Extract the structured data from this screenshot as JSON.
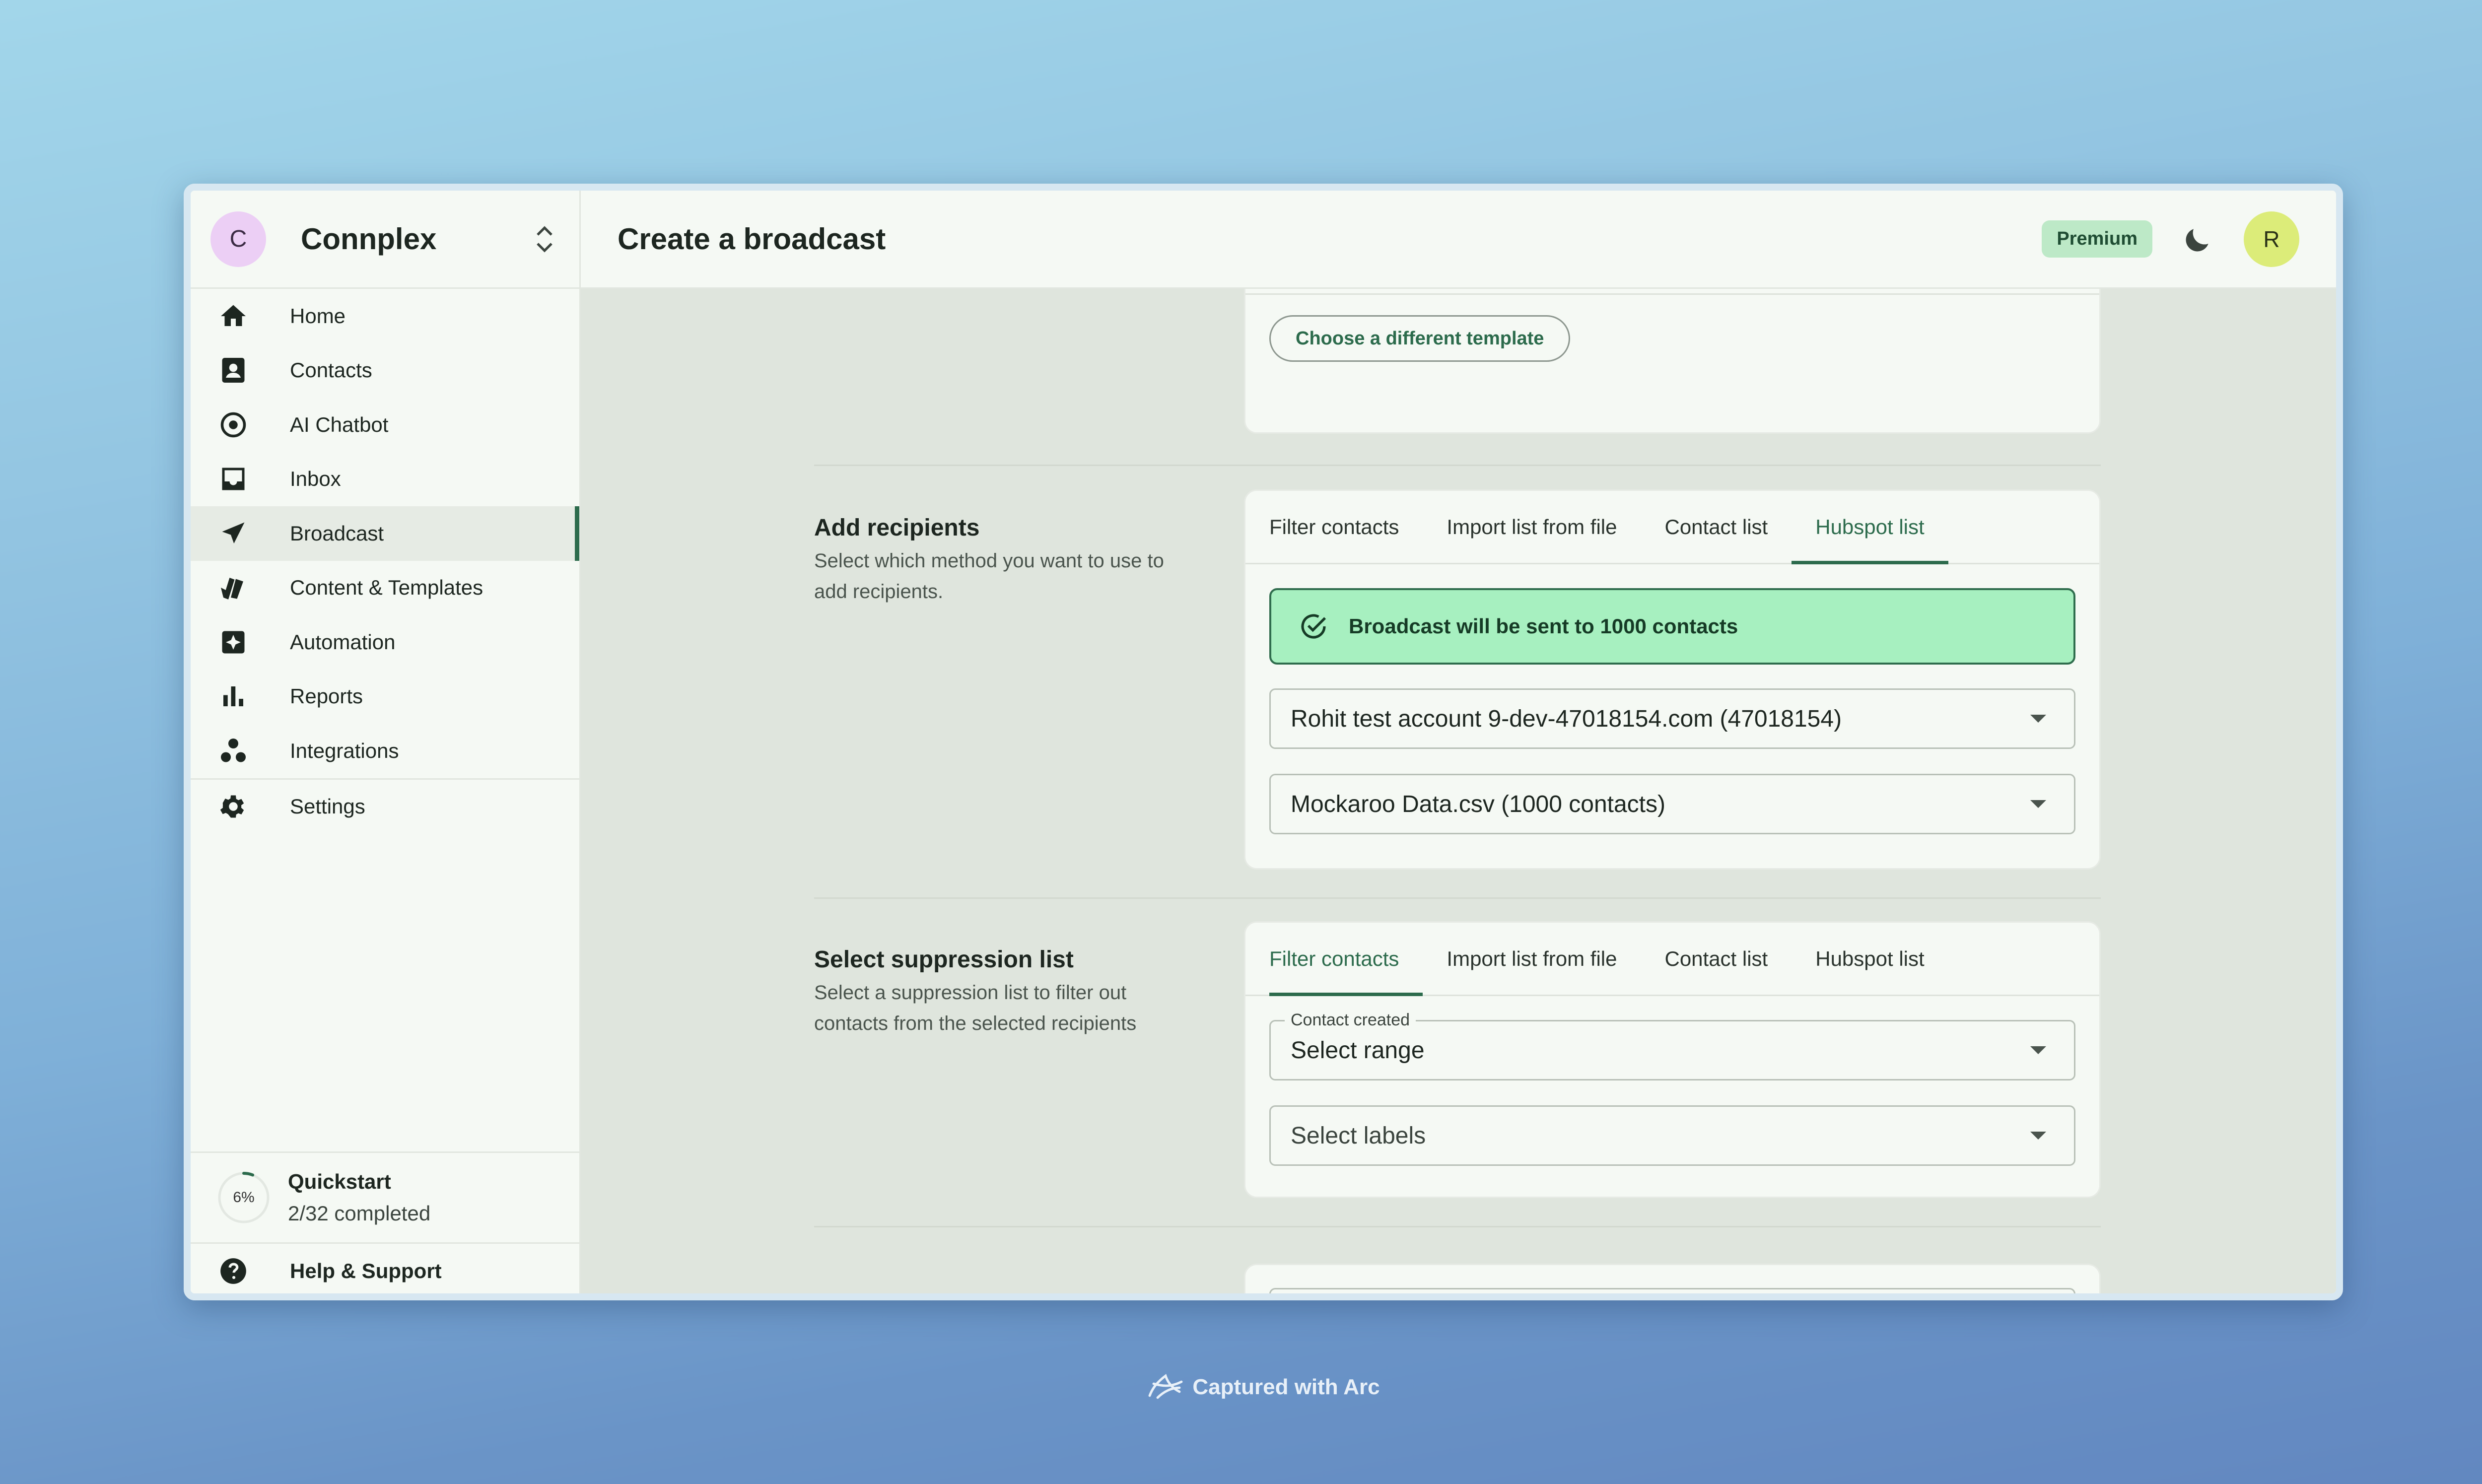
{
  "brand": {
    "initial": "C",
    "name": "Connplex"
  },
  "header": {
    "title": "Create a broadcast",
    "plan_badge": "Premium",
    "user_initial": "R"
  },
  "sidebar": {
    "items": [
      {
        "label": "Home",
        "icon": "home-icon"
      },
      {
        "label": "Contacts",
        "icon": "contact-card-icon"
      },
      {
        "label": "AI Chatbot",
        "icon": "chatbot-icon"
      },
      {
        "label": "Inbox",
        "icon": "inbox-icon"
      },
      {
        "label": "Broadcast",
        "icon": "send-icon",
        "active": true
      },
      {
        "label": "Content & Templates",
        "icon": "templates-icon"
      },
      {
        "label": "Automation",
        "icon": "automation-icon"
      },
      {
        "label": "Reports",
        "icon": "bar-chart-icon"
      },
      {
        "label": "Integrations",
        "icon": "integrations-icon"
      },
      {
        "label": "Settings",
        "icon": "gear-icon"
      }
    ],
    "quickstart": {
      "percent": "6%",
      "progress": 0.06,
      "title": "Quickstart",
      "status": "2/32 completed"
    },
    "help_label": "Help & Support"
  },
  "template_section": {
    "choose_button": "Choose a different template"
  },
  "recipients": {
    "title": "Add recipients",
    "description": "Select which method you want to use to add recipients.",
    "tabs": [
      "Filter contacts",
      "Import list from file",
      "Contact list",
      "Hubspot list"
    ],
    "active_tab": "Hubspot list",
    "alert": "Broadcast will be sent to 1000 contacts",
    "account_select": "Rohit test account 9-dev-47018154.com (47018154)",
    "list_select": "Mockaroo Data.csv (1000 contacts)"
  },
  "suppression": {
    "title": "Select suppression list",
    "description": "Select a suppression list to filter out contacts from the selected recipients",
    "tabs": [
      "Filter contacts",
      "Import list from file",
      "Contact list",
      "Hubspot list"
    ],
    "active_tab": "Filter contacts",
    "contact_created_label": "Contact created",
    "contact_created_value": "Select range",
    "labels_placeholder": "Select labels"
  },
  "footer": {
    "text": "Captured with Arc"
  },
  "colors": {
    "accent": "#2c6b4c",
    "success_bg": "#a7f0c0",
    "premium_bg": "#bde9c7",
    "user_avatar": "#dcec79",
    "brand_avatar": "#eccff5"
  }
}
